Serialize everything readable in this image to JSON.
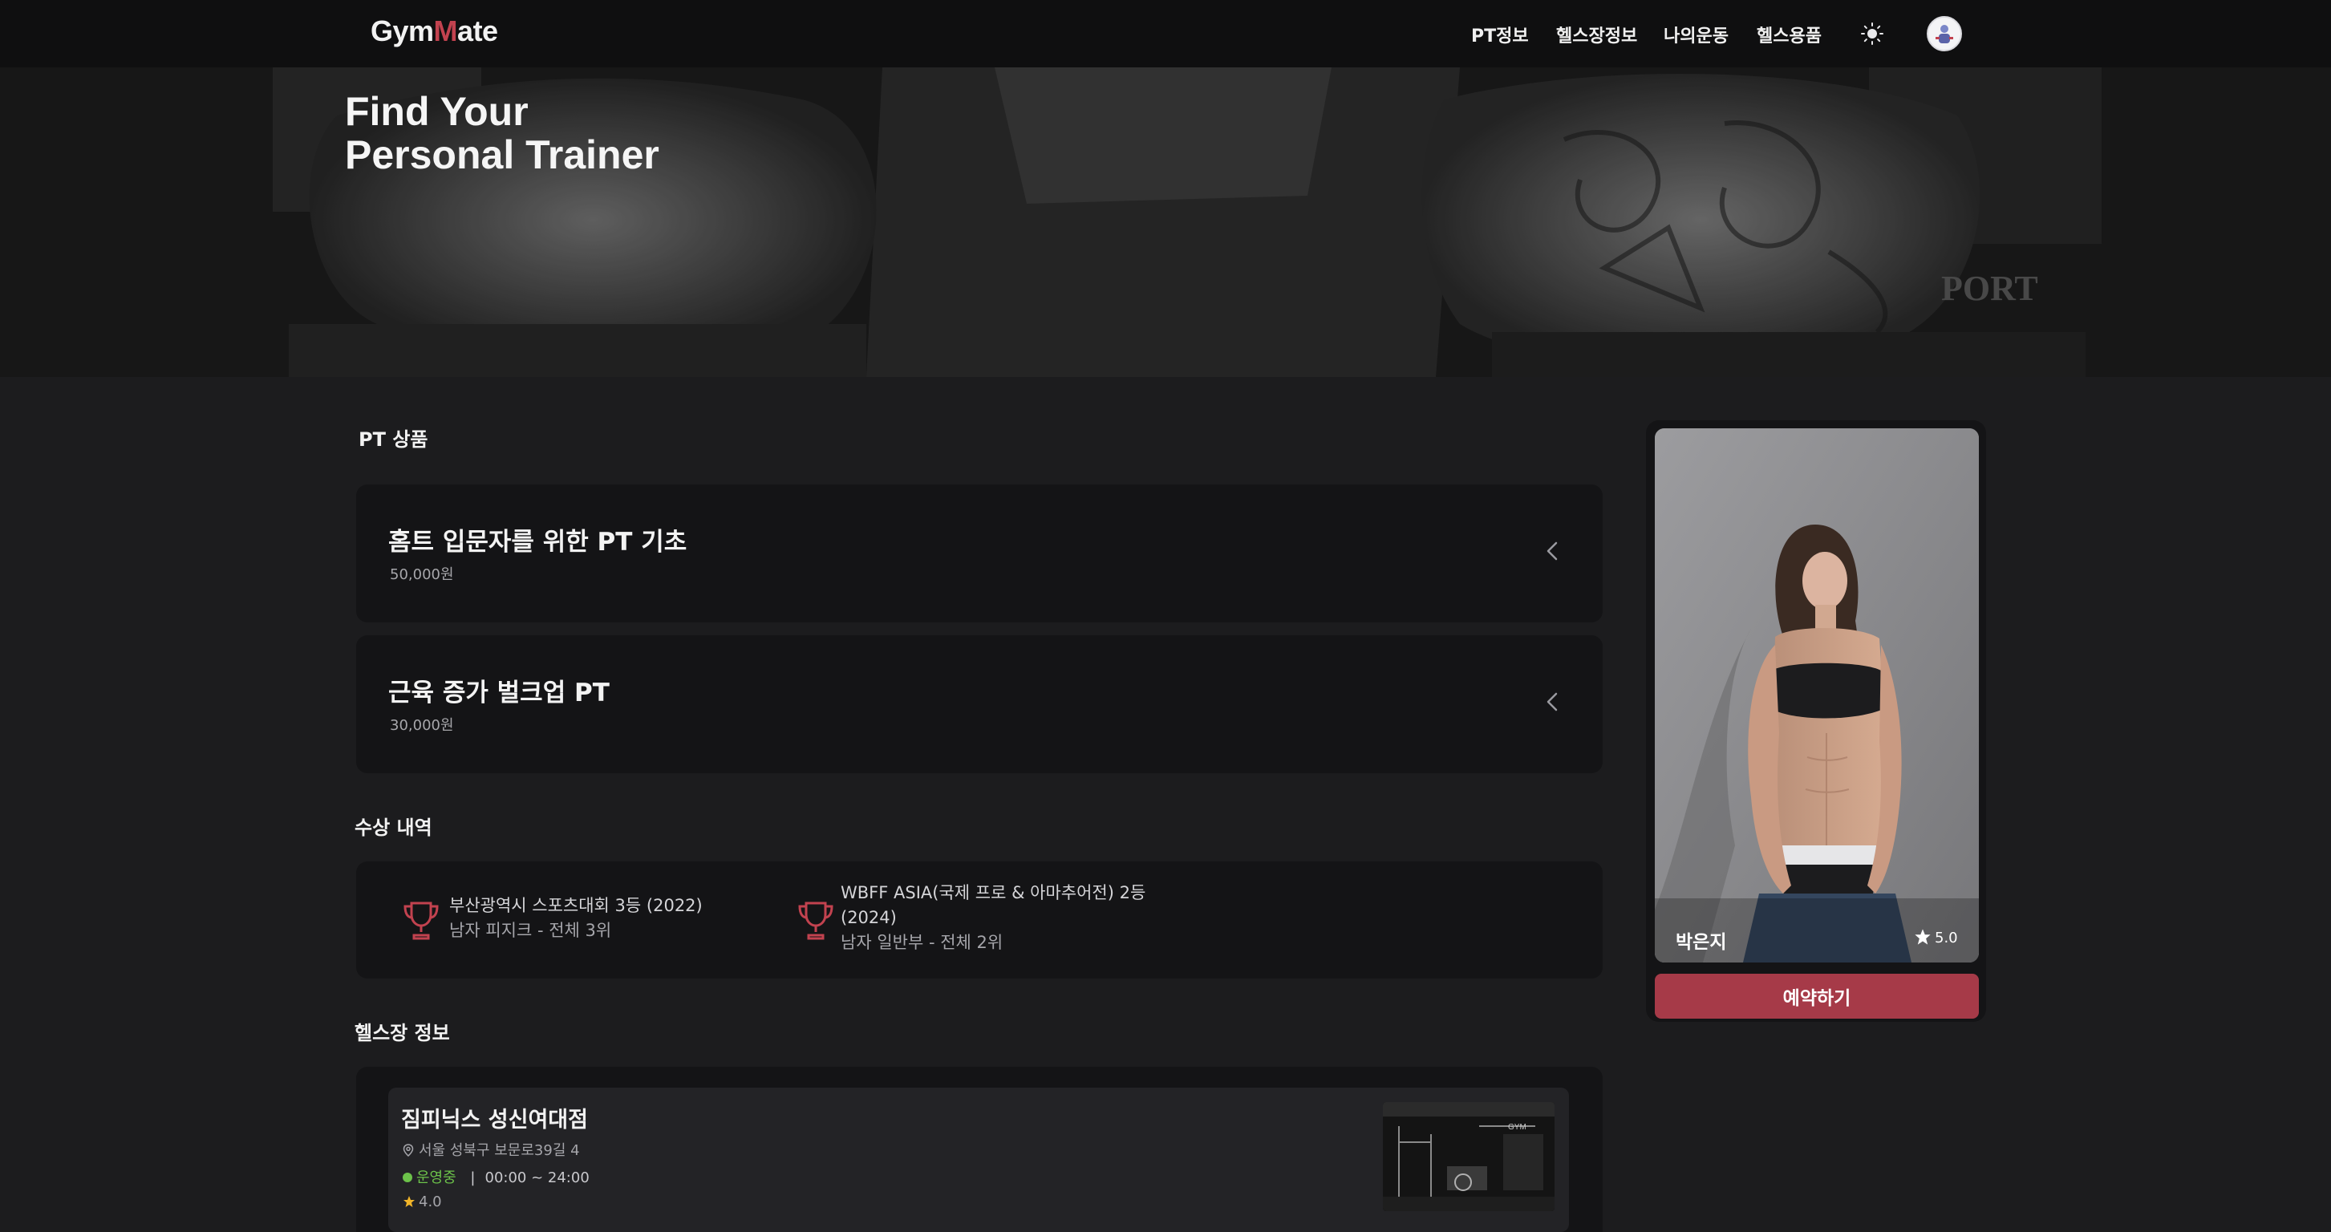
{
  "header": {
    "logo_prefix": "Gym",
    "logo_m": "M",
    "logo_suffix": "ate",
    "nav": [
      "PT정보",
      "헬스장정보",
      "나의운동",
      "헬스용품"
    ],
    "theme_icon": "sun-icon",
    "avatar_icon": "user-avatar"
  },
  "hero": {
    "title_line1": "Find Your",
    "title_line2": "Personal Trainer"
  },
  "pt_products": {
    "section_title": "PT 상품",
    "items": [
      {
        "name": "홈트 입문자를 위한 PT 기초",
        "price": "50,000원"
      },
      {
        "name": "근육 증가 벌크업 PT",
        "price": "30,000원"
      }
    ],
    "expand_icon": "chevron-left-icon"
  },
  "awards": {
    "section_title": "수상 내역",
    "items": [
      {
        "title": "부산광역시 스포츠대회 3등 (2022)",
        "detail": "남자 피지크 - 전체 3위"
      },
      {
        "title": "WBFF ASIA(국제 프로 & 아마추어전) 2등 (2024)",
        "detail": "남자 일반부 - 전체 2위"
      }
    ],
    "icon": "trophy-icon",
    "accent": "#c2424f"
  },
  "gym_info": {
    "section_title": "헬스장 정보",
    "name": "짐피닉스 성신여대점",
    "address": "서울 성북구 보문로39길 4",
    "status": "운영중",
    "hours": "00:00 ~ 24:00",
    "rating": "4.0",
    "status_color": "#6cc24a"
  },
  "trainer": {
    "name": "박은지",
    "rating": "5.0",
    "reserve_label": "예약하기",
    "button_color": "#a63a48"
  }
}
